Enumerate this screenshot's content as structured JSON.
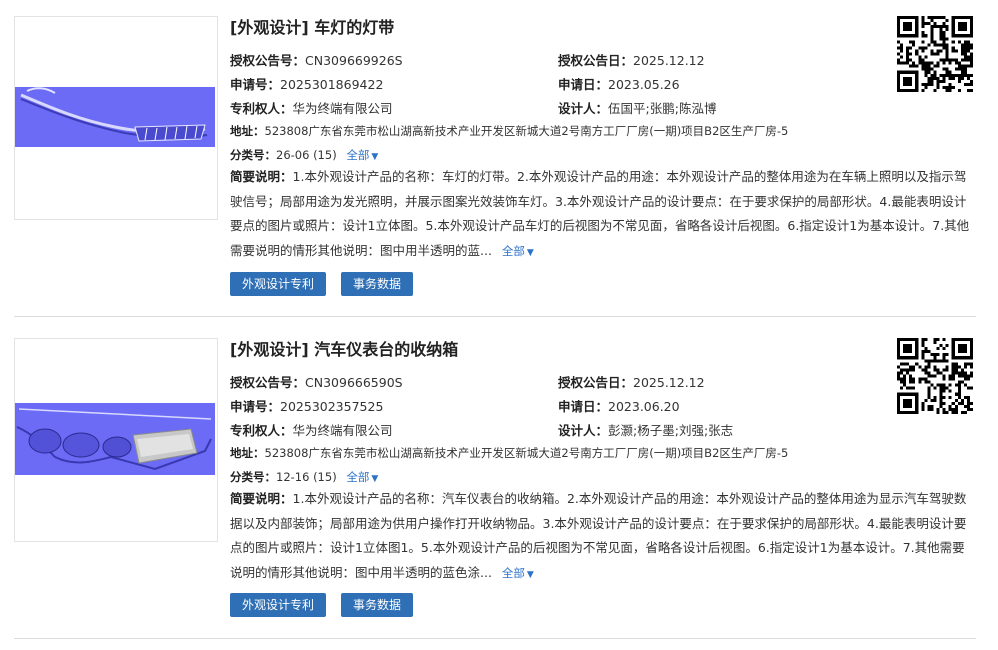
{
  "records": [
    {
      "title": "[外观设计] 车灯的灯带",
      "grant_no_label": "授权公告号：",
      "grant_no": "CN309669926S",
      "grant_date_label": "授权公告日：",
      "grant_date": "2025.12.12",
      "app_no_label": "申请号：",
      "app_no": "2025301869422",
      "app_date_label": "申请日：",
      "app_date": "2023.05.26",
      "owner_label": "专利权人：",
      "owner": "华为终端有限公司",
      "designer_label": "设计人：",
      "designer": "伍国平;张鹏;陈泓博",
      "address_label": "地址：",
      "address": "523808广东省东莞市松山湖高新技术产业开发区新城大道2号南方工厂厂房(一期)项目B2区生产厂房-5",
      "class_label": "分类号：",
      "class": "26-06 (15)",
      "expand_label": "全部",
      "desc_label": "简要说明：",
      "desc": "1.本外观设计产品的名称：车灯的灯带。2.本外观设计产品的用途：本外观设计产品的整体用途为在车辆上照明以及指示驾驶信号；局部用途为发光照明，并展示图案光效装饰车灯。3.本外观设计产品的设计要点：在于要求保护的局部形状。4.最能表明设计要点的图片或照片：设计1立体图。5.本外观设计产品车灯的后视图为不常见面，省略各设计后视图。6.指定设计1为基本设计。7.其他需要说明的情形其他说明：图中用半透明的蓝...",
      "btn_design": "外观设计专利",
      "btn_affairs": "事务数据"
    },
    {
      "title": "[外观设计] 汽车仪表台的收纳箱",
      "grant_no_label": "授权公告号：",
      "grant_no": "CN309666590S",
      "grant_date_label": "授权公告日：",
      "grant_date": "2025.12.12",
      "app_no_label": "申请号：",
      "app_no": "2025302357525",
      "app_date_label": "申请日：",
      "app_date": "2023.06.20",
      "owner_label": "专利权人：",
      "owner": "华为终端有限公司",
      "designer_label": "设计人：",
      "designer": "彭灏;杨子墨;刘强;张志",
      "address_label": "地址：",
      "address": "523808广东省东莞市松山湖高新技术产业开发区新城大道2号南方工厂厂房(一期)项目B2区生产厂房-5",
      "class_label": "分类号：",
      "class": "12-16 (15)",
      "expand_label": "全部",
      "desc_label": "简要说明：",
      "desc": "1.本外观设计产品的名称：汽车仪表台的收纳箱。2.本外观设计产品的用途：本外观设计产品的整体用途为显示汽车驾驶数据以及内部装饰；局部用途为供用户操作打开收纳物品。3.本外观设计产品的设计要点：在于要求保护的局部形状。4.最能表明设计要点的图片或照片：设计1立体图1。5.本外观设计产品的后视图为不常见面，省略各设计后视图。6.指定设计1为基本设计。7.其他需要说明的情形其他说明：图中用半透明的蓝色涂...",
      "btn_design": "外观设计专利",
      "btn_affairs": "事务数据"
    }
  ],
  "colors": {
    "accent": "#2f6fb5",
    "link": "#2b73c9",
    "band": "#6b6bf5"
  },
  "icons": {
    "qr": "qr-code-icon",
    "caret": "caret-down-icon"
  }
}
